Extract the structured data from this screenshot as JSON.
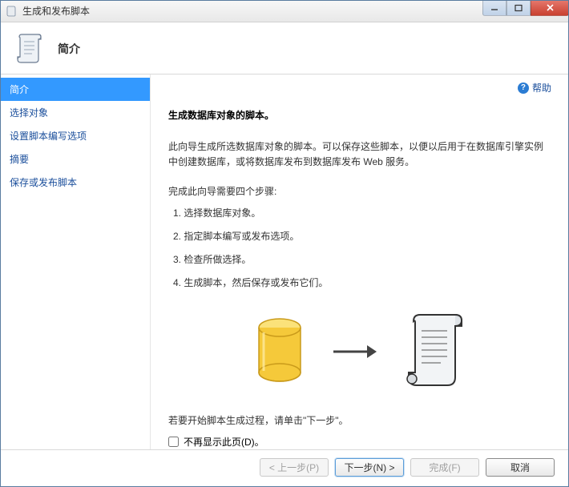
{
  "window": {
    "title": "生成和发布脚本"
  },
  "header": {
    "title": "简介"
  },
  "sidebar": {
    "items": [
      {
        "label": "简介",
        "active": true
      },
      {
        "label": "选择对象",
        "active": false
      },
      {
        "label": "设置脚本编写选项",
        "active": false
      },
      {
        "label": "摘要",
        "active": false
      },
      {
        "label": "保存或发布脚本",
        "active": false
      }
    ]
  },
  "help": {
    "label": "帮助"
  },
  "main": {
    "heading": "生成数据库对象的脚本。",
    "paragraph": "此向导生成所选数据库对象的脚本。可以保存这些脚本，以便以后用于在数据库引擎实例中创建数据库，或将数据库发布到数据库发布 Web 服务。",
    "steps_intro": "完成此向导需要四个步骤:",
    "steps": [
      "1. 选择数据库对象。",
      "2. 指定脚本编写或发布选项。",
      "3. 检查所做选择。",
      "4. 生成脚本，然后保存或发布它们。"
    ],
    "instruction": "若要开始脚本生成过程，请单击\"下一步\"。",
    "checkbox_label": "不再显示此页(D)。"
  },
  "footer": {
    "back": "< 上一步(P)",
    "next": "下一步(N) >",
    "finish": "完成(F)",
    "cancel": "取消"
  }
}
